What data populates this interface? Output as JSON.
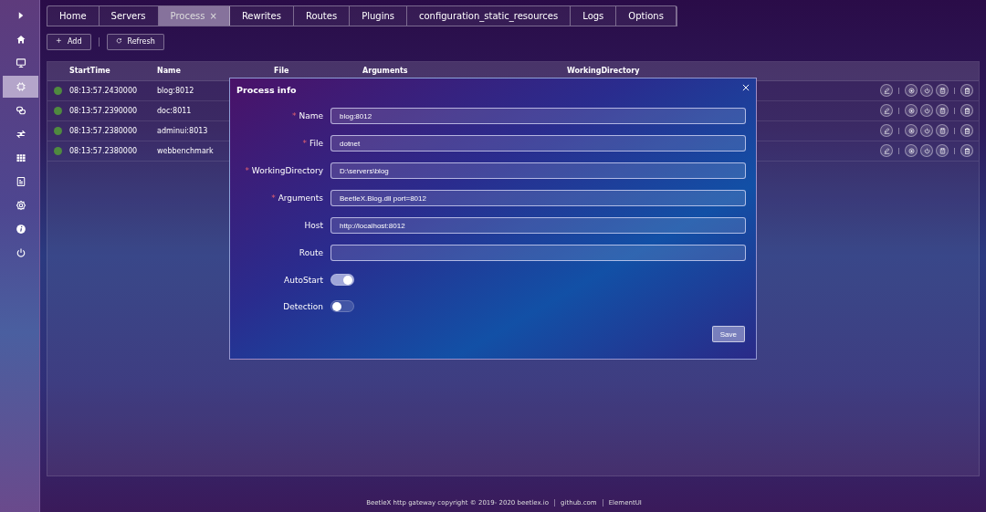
{
  "sidebar": {
    "items": [
      {
        "kind": "expand",
        "selected": false
      },
      {
        "kind": "home",
        "selected": false
      },
      {
        "kind": "monitor",
        "selected": false
      },
      {
        "kind": "chip",
        "selected": true
      },
      {
        "kind": "links",
        "selected": false
      },
      {
        "kind": "transfer",
        "selected": false
      },
      {
        "kind": "grid",
        "selected": false
      },
      {
        "kind": "document",
        "selected": false
      },
      {
        "kind": "gear",
        "selected": false
      },
      {
        "kind": "info",
        "selected": false
      },
      {
        "kind": "power",
        "selected": false
      }
    ]
  },
  "tabs": [
    {
      "label": "Home",
      "selected": false
    },
    {
      "label": "Servers",
      "selected": false
    },
    {
      "label": "Process",
      "selected": true,
      "close": "×"
    },
    {
      "label": "Rewrites",
      "selected": false
    },
    {
      "label": "Routes",
      "selected": false
    },
    {
      "label": "Plugins",
      "selected": false
    },
    {
      "label": "configuration_static_resources",
      "selected": false
    },
    {
      "label": "Logs",
      "selected": false
    },
    {
      "label": "Options",
      "selected": false
    }
  ],
  "toolbar": {
    "buttons": [
      {
        "kind": "add",
        "label": "Add"
      },
      {
        "kind": "refresh",
        "label": "Refresh"
      }
    ]
  },
  "table": {
    "columns": [
      "StartTime",
      "Name",
      "File",
      "Arguments",
      "WorkingDirectory"
    ],
    "rows": [
      {
        "color": "#4f8a3f",
        "start_time": "08:13:57.2430000",
        "name": "blog:8012"
      },
      {
        "color": "#4f8a3f",
        "start_time": "08:13:57.2390000",
        "name": "doc:8011"
      },
      {
        "color": "#4f8a3f",
        "start_time": "08:13:57.2380000",
        "name": "adminui:8013"
      },
      {
        "color": "#4f8a3f",
        "start_time": "08:13:57.2380000",
        "name": "webbenchmark"
      }
    ]
  },
  "dialog": {
    "title": "Process info",
    "fields": [
      {
        "label": "Name",
        "required_mark": "*",
        "value": "blog:8012"
      },
      {
        "label": "File",
        "required_mark": "*",
        "value": "dotnet"
      },
      {
        "label": "WorkingDirectory",
        "required_mark": "*",
        "value": "D:\\servers\\blog"
      },
      {
        "label": "Arguments",
        "required_mark": "*",
        "value": "BeetleX.Blog.dll port=8012"
      },
      {
        "label": "Host",
        "value": "http://localhost:8012"
      },
      {
        "label": "Route"
      }
    ],
    "toggles": [
      {
        "label": "AutoStart",
        "on": true
      },
      {
        "label": "Detection",
        "on": false
      }
    ],
    "save": "Save"
  },
  "footer": {
    "text": "BeetleX http gateway copyright © 2019- 2020 beetlex.io",
    "links": [
      "github.com",
      "ElementUI"
    ]
  }
}
